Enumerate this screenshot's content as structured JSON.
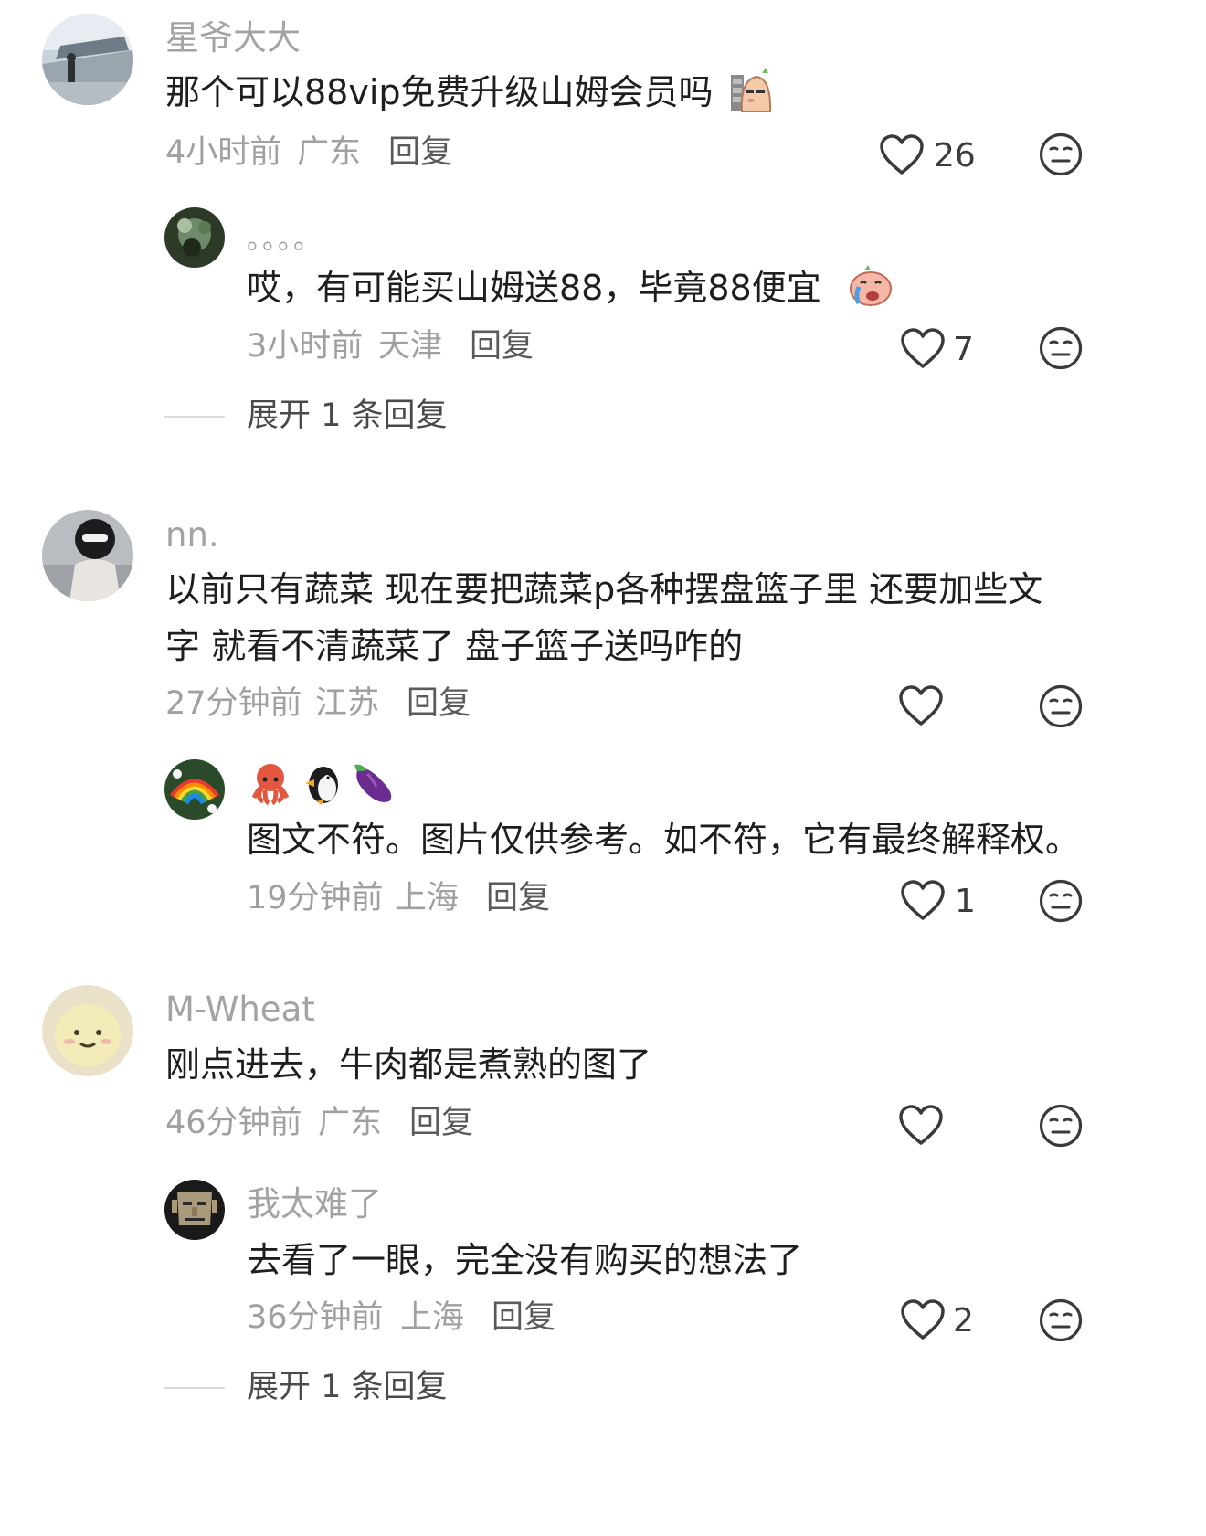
{
  "comments": [
    {
      "username": "星爷大大",
      "text": "那个可以88vip免费升级山姆会员吗",
      "time": "4小时前",
      "location": "广东",
      "reply_label": "回复",
      "likes": "26",
      "replies": [
        {
          "username": "。。。。",
          "text": "哎，有可能买山姆送88，毕竟88便宜",
          "time": "3小时前",
          "location": "天津",
          "reply_label": "回复",
          "likes": "7"
        }
      ],
      "expand_label": "展开 1 条回复"
    },
    {
      "username": "nn.",
      "text_line1": "以前只有蔬菜 现在要把蔬菜p各种摆盘篮子里 还要加些文",
      "text_line2": "字 就看不清蔬菜了 盘子篮子送吗咋的",
      "time": "27分钟前",
      "location": "江苏",
      "reply_label": "回复",
      "likes": "",
      "replies": [
        {
          "username_emoji": [
            "octopus-icon",
            "penguin-icon",
            "eggplant-icon"
          ],
          "text": "图文不符。图片仅供参考。如不符，它有最终解释权。",
          "time": "19分钟前",
          "location": "上海",
          "reply_label": "回复",
          "likes": "1"
        }
      ]
    },
    {
      "username": "M-Wheat",
      "text": "刚点进去，牛肉都是煮熟的图了",
      "time": "46分钟前",
      "location": "广东",
      "reply_label": "回复",
      "likes": "",
      "replies": [
        {
          "username": "我太难了",
          "text": "去看了一眼，完全没有购买的想法了",
          "time": "36分钟前",
          "location": "上海",
          "reply_label": "回复",
          "likes": "2"
        }
      ],
      "expand_label": "展开 1 条回复"
    }
  ],
  "icons": {
    "like": "heart-outline-icon",
    "dislike": "neutral-face-icon"
  },
  "colors": {
    "username": "#a3a3a3",
    "meta": "#a0a0a0",
    "text": "#1e1e1e"
  }
}
